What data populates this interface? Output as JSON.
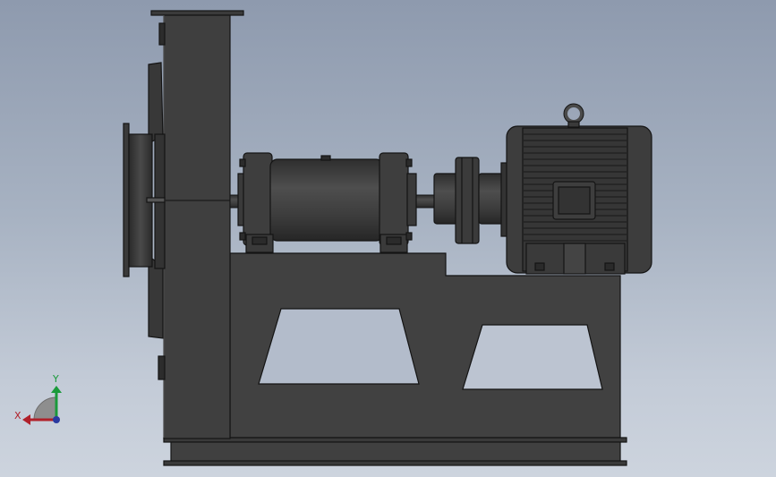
{
  "viewport": {
    "background_top": "#8e9aae",
    "background_bottom": "#cdd4de"
  },
  "model": {
    "body_color": "#404040",
    "edge_color": "#141414",
    "highlight_color": "#5a5a5a",
    "parts": [
      "blower-housing",
      "inlet-flange",
      "bearing-housing",
      "coupling",
      "electric-motor",
      "lifting-eye",
      "terminal-box",
      "base-frame"
    ]
  },
  "triad": {
    "x_label": "X",
    "y_label": "Y",
    "x_color": "#b0202a",
    "y_color": "#1a9a3a",
    "z_color": "#2a3aa0"
  }
}
